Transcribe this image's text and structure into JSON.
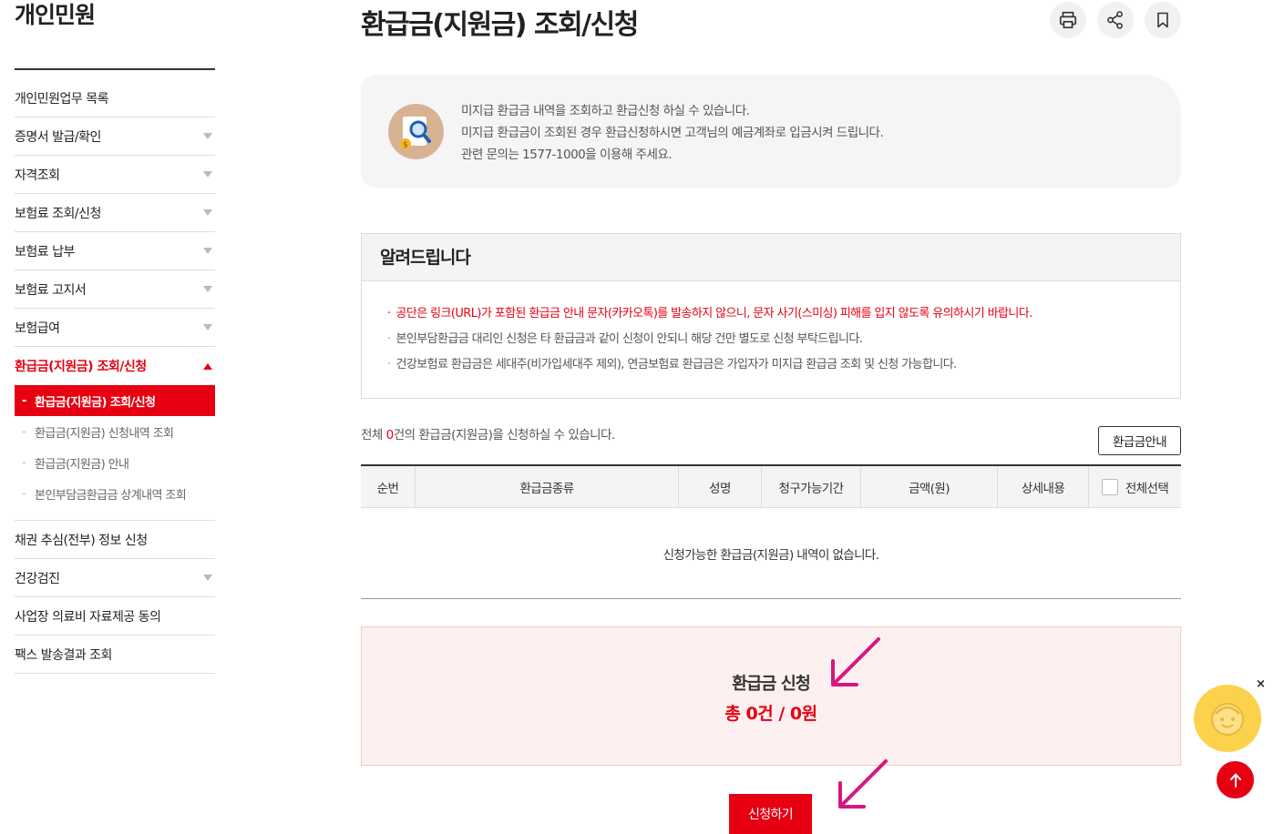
{
  "sidebar": {
    "title": "개인민원",
    "items": [
      {
        "label": "개인민원업무 목록",
        "expandable": false
      },
      {
        "label": "증명서 발급/확인",
        "expandable": true
      },
      {
        "label": "자격조회",
        "expandable": true
      },
      {
        "label": "보험료 조회/신청",
        "expandable": true
      },
      {
        "label": "보험료 납부",
        "expandable": true
      },
      {
        "label": "보험료 고지서",
        "expandable": true
      },
      {
        "label": "보험급여",
        "expandable": true
      },
      {
        "label": "환급금(지원금) 조회/신청",
        "expandable": true,
        "active": true
      }
    ],
    "subitems": [
      {
        "label": "환급금(지원금) 조회/신청",
        "active": true
      },
      {
        "label": "환급금(지원금) 신청내역 조회"
      },
      {
        "label": "환급금(지원금) 안내"
      },
      {
        "label": "본인부담금환급금 상계내역 조회"
      }
    ],
    "items_after": [
      {
        "label": "채권 추심(전부) 정보 신청",
        "expandable": false
      },
      {
        "label": "건강검진",
        "expandable": true
      },
      {
        "label": "사업장 의료비 자료제공 동의",
        "expandable": false
      },
      {
        "label": "팩스 발송결과 조회",
        "expandable": false
      }
    ]
  },
  "header": {
    "title": "환급금(지원금) 조회/신청",
    "tools": [
      "print-icon",
      "share-icon",
      "bookmark-icon"
    ]
  },
  "info": {
    "icon": "search-document-icon",
    "lines": [
      "미지급 환급금 내역을 조회하고 환급신청 하실 수 있습니다.",
      "미지급 환급금이 조회된 경우 환급신청하시면 고객님의 예금계좌로 입금시켜 드립니다.",
      "관련 문의는 1577-1000을 이용해 주세요."
    ]
  },
  "notice": {
    "title": "알려드립니다",
    "lines": [
      "공단은 링크(URL)가 포함된 환급금 안내 문자(카카오톡)를 발송하지 않으니, 문자 사기(스미싱) 피해를 입지 않도록 유의하시기 바랍니다.",
      "본인부담환급금 대리인 신청은 타 환급금과 같이 신청이 안되니 해당 건만 별도로 신청 부탁드립니다.",
      "건강보험료 환급금은 세대주(비가입세대주 제외), 연금보험료 환급금은 가입자가 미지급 환급금 조회 및 신청 가능합니다."
    ]
  },
  "list": {
    "count_prefix": "전체 ",
    "count": "0",
    "count_suffix": "건의 환급금(지원금)을 신청하실 수 있습니다.",
    "guide_button": "환급금안내",
    "columns": [
      "순번",
      "환급금종류",
      "성명",
      "청구가능기간",
      "금액(원)",
      "상세내용",
      "전체선택"
    ],
    "empty_message": "신청가능한 환급금(지원금) 내역이 없습니다."
  },
  "summary": {
    "title": "환급금 신청",
    "total": "총 0건 / 0원"
  },
  "apply_button": "신청하기",
  "floating": {
    "chatbot_icon": "chatbot-face-icon",
    "close_label": "×",
    "top_icon": "arrow-up-icon"
  },
  "colors": {
    "accent": "#e60012",
    "annotation_arrow": "#d6177f",
    "chatbot": "#fcd24c"
  }
}
